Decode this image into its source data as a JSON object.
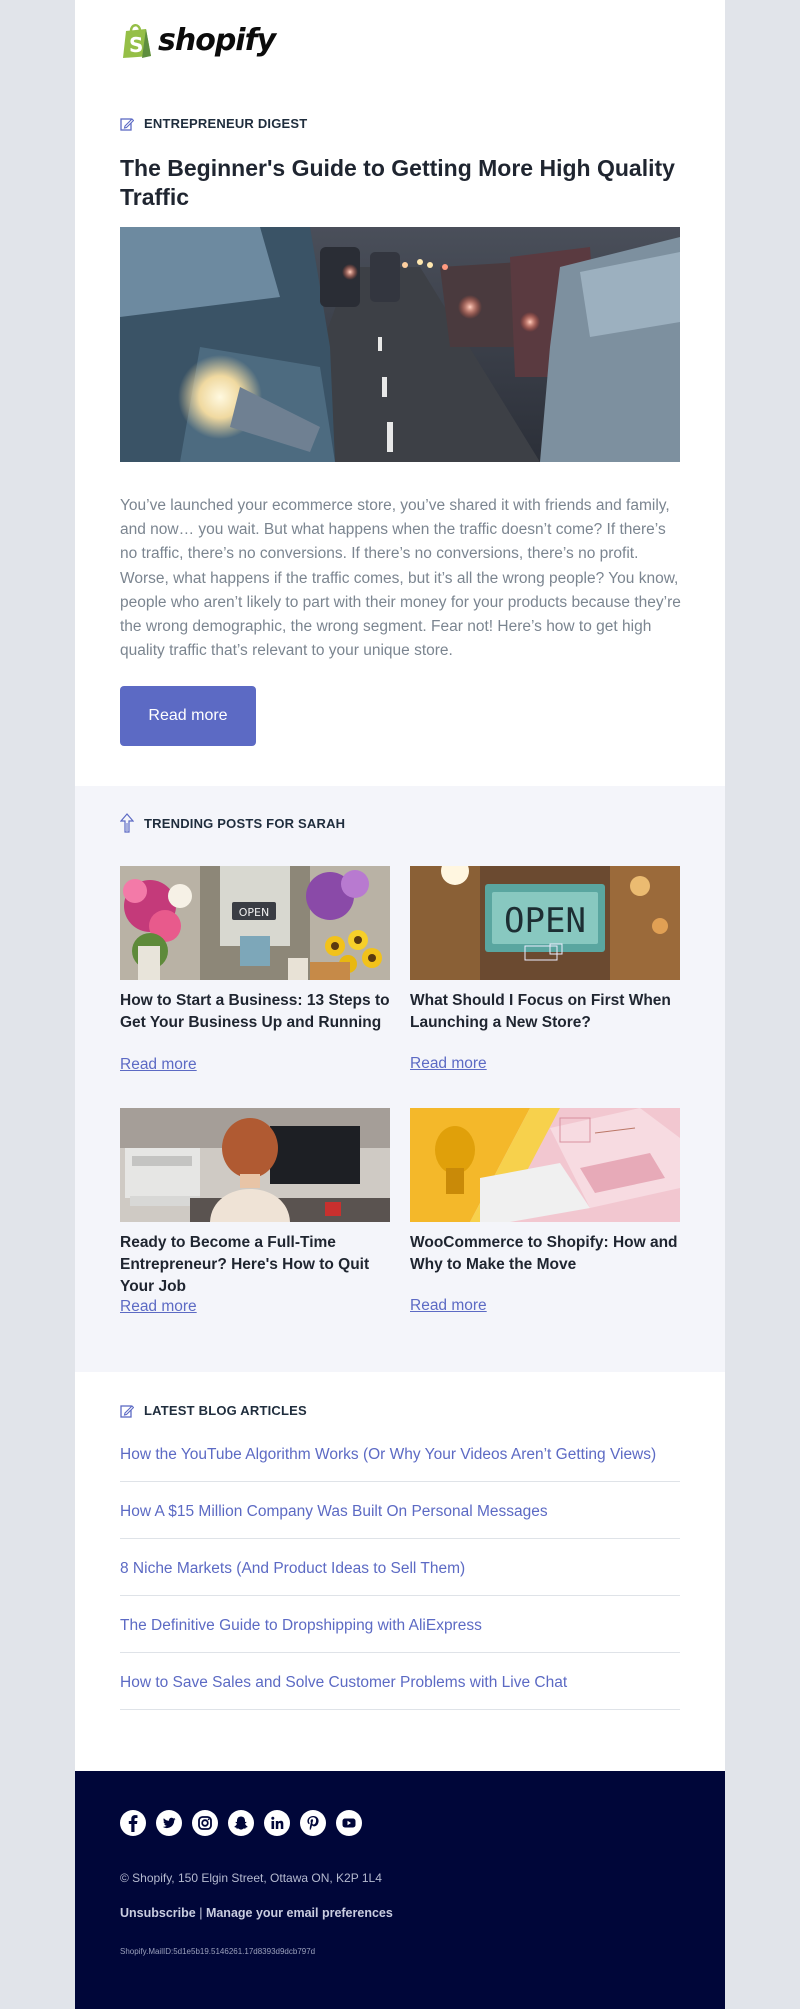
{
  "brand": {
    "logo_text": "shopify"
  },
  "hero": {
    "eyebrow": "ENTREPRENEUR DIGEST",
    "title": "The Beginner's Guide to Getting More High Quality Traffic",
    "image_icon": "traffic-jam-photo",
    "body": "You’ve launched your ecommerce store, you’ve shared it with friends and family, and now… you wait. But what happens when the traffic doesn’t come? If there’s no traffic, there’s no conversions. If there’s no conversions, there’s no profit. Worse, what happens if the traffic comes, but it’s all the wrong people? You know, people who aren’t likely to part with their money for your products because they’re the wrong demographic, the wrong segment. Fear not! Here’s how to get high quality traffic that’s relevant to your unique store.",
    "button_label": "Read more"
  },
  "trending": {
    "eyebrow": "TRENDING POSTS FOR SARAH",
    "cards": [
      {
        "title": "How to Start a Business: 13 Steps to Get Your Business Up and Running",
        "link": "Read more",
        "image_icon": "flower-shop-photo",
        "sign_text": "OPEN"
      },
      {
        "title": "What Should I Focus on First When Launching a New Store?",
        "link": "Read more",
        "image_icon": "open-sign-photo",
        "sign_text": "OPEN"
      },
      {
        "title": "Ready to Become a Full-Time Entrepreneur? Here's How to Quit Your Job",
        "link": "Read more",
        "image_icon": "office-desk-photo"
      },
      {
        "title": "WooCommerce to Shopify: How and Why to Make the Move",
        "link": "Read more",
        "image_icon": "desk-flatlay-photo"
      }
    ]
  },
  "latest": {
    "eyebrow": "LATEST BLOG ARTICLES",
    "articles": [
      "How the YouTube Algorithm Works (Or Why Your Videos Aren’t Getting Views)",
      "How A $15 Million Company Was Built On Personal Messages",
      "8 Niche Markets (And Product Ideas to Sell Them)",
      "The Definitive Guide to Dropshipping with AliExpress",
      "How to Save Sales and Solve Customer Problems with Live Chat"
    ]
  },
  "footer": {
    "socials": [
      "facebook-icon",
      "twitter-icon",
      "instagram-icon",
      "snapchat-icon",
      "linkedin-icon",
      "pinterest-icon",
      "youtube-icon"
    ],
    "address": "© Shopify,  150 Elgin Street, Ottawa ON, K2P 1L4",
    "unsubscribe": "Unsubscribe",
    "separator": "|",
    "manage": "Manage your email preferences",
    "mail_id": "Shopify.MailID:5d1e5b19.5146261.17d8393d9dcb797d"
  },
  "colors": {
    "accent": "#5c6ac4",
    "footer_bg": "#000639",
    "trending_bg": "#f4f5fa",
    "page_bg": "#e1e4ea",
    "logo_green": "#95bf47"
  }
}
